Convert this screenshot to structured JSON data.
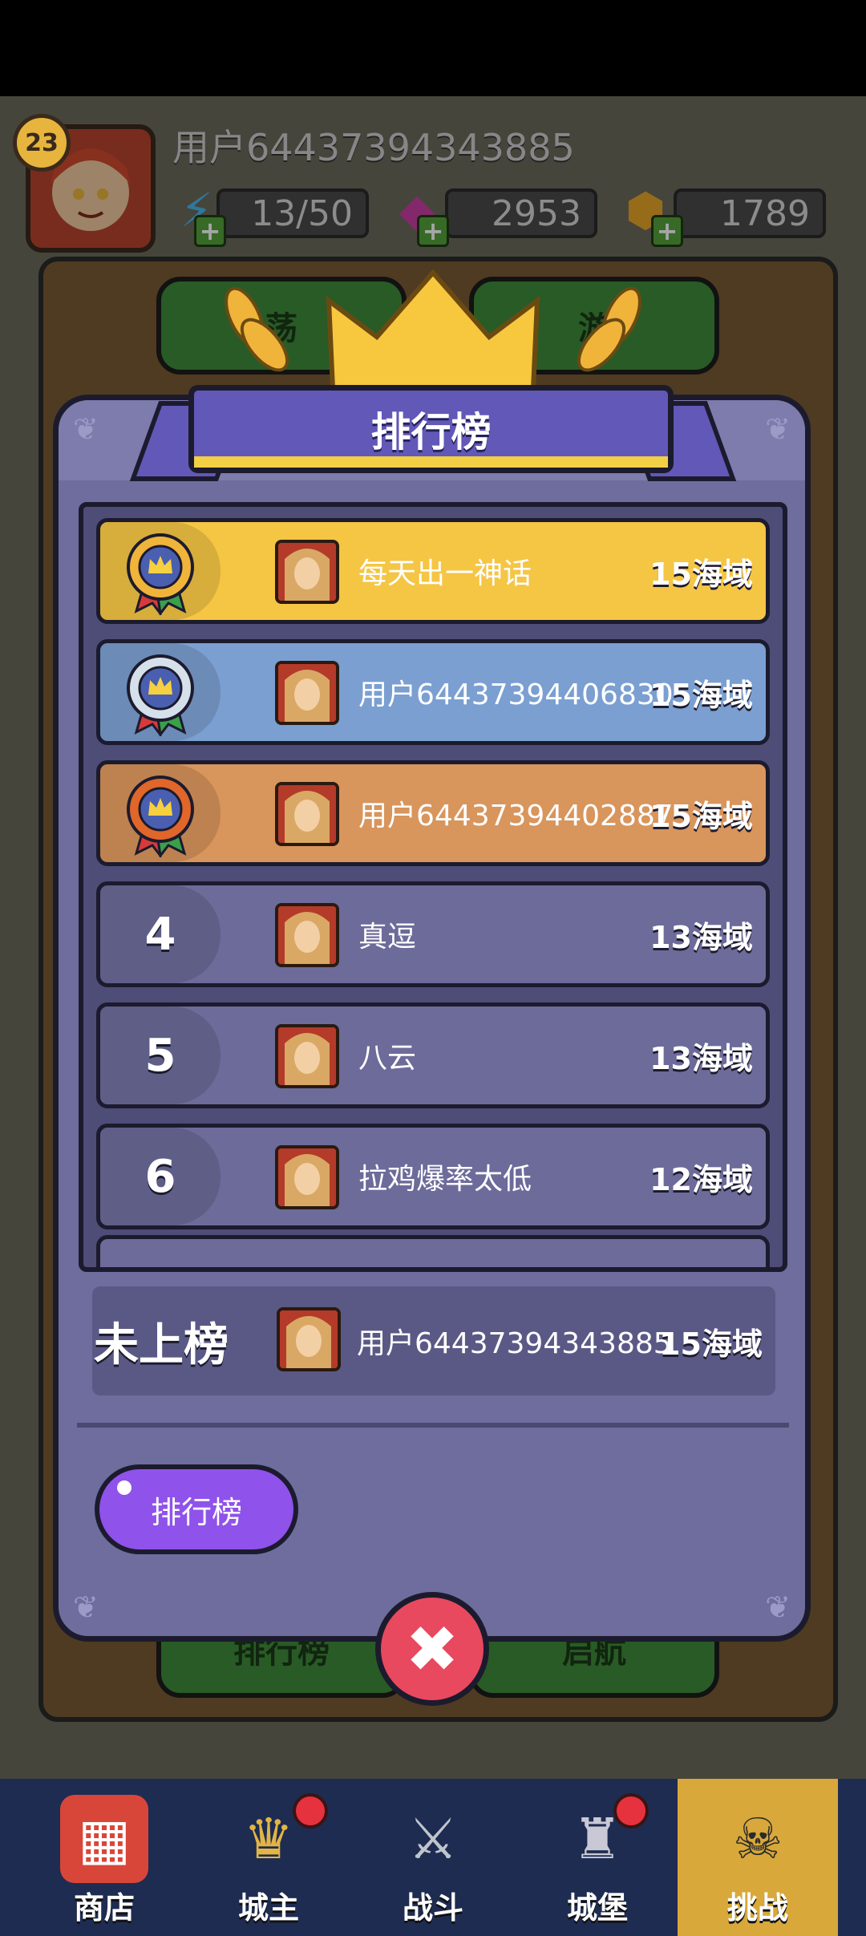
{
  "top_bar": {
    "level": "23",
    "username": "用户64437394343885",
    "energy": "13/50",
    "gems": "2953",
    "coins": "1789"
  },
  "background_buttons": [
    "荡",
    "游",
    "排行榜",
    "启航"
  ],
  "modal": {
    "title": "排行榜",
    "rows": [
      {
        "rank": "1",
        "name": "每天出一神话",
        "score": "15海域",
        "color": "#f5c544"
      },
      {
        "rank": "2",
        "name": "用户64437394406830",
        "score": "15海域",
        "color": "#7b9fd1"
      },
      {
        "rank": "3",
        "name": "用户64437394402887",
        "score": "15海域",
        "color": "#d8955c"
      },
      {
        "rank": "4",
        "name": "真逗",
        "score": "13海域",
        "color": "#6c6b9a"
      },
      {
        "rank": "5",
        "name": "八云",
        "score": "13海域",
        "color": "#6c6b9a"
      },
      {
        "rank": "6",
        "name": "拉鸡爆率太低",
        "score": "12海域",
        "color": "#6c6b9a"
      }
    ],
    "me": {
      "label": "未上榜",
      "name": "用户64437394343885",
      "score": "15海域"
    },
    "leaderboard_button": "排行榜",
    "close_icon": "close-icon"
  },
  "bottom_nav": [
    {
      "label": "商店",
      "icon": "shop-icon",
      "badge": false
    },
    {
      "label": "城主",
      "icon": "crown-icon",
      "badge": true
    },
    {
      "label": "战斗",
      "icon": "battle-icon",
      "badge": false
    },
    {
      "label": "城堡",
      "icon": "castle-icon",
      "badge": true
    },
    {
      "label": "挑战",
      "icon": "challenge-icon",
      "badge": false,
      "active": true
    }
  ]
}
